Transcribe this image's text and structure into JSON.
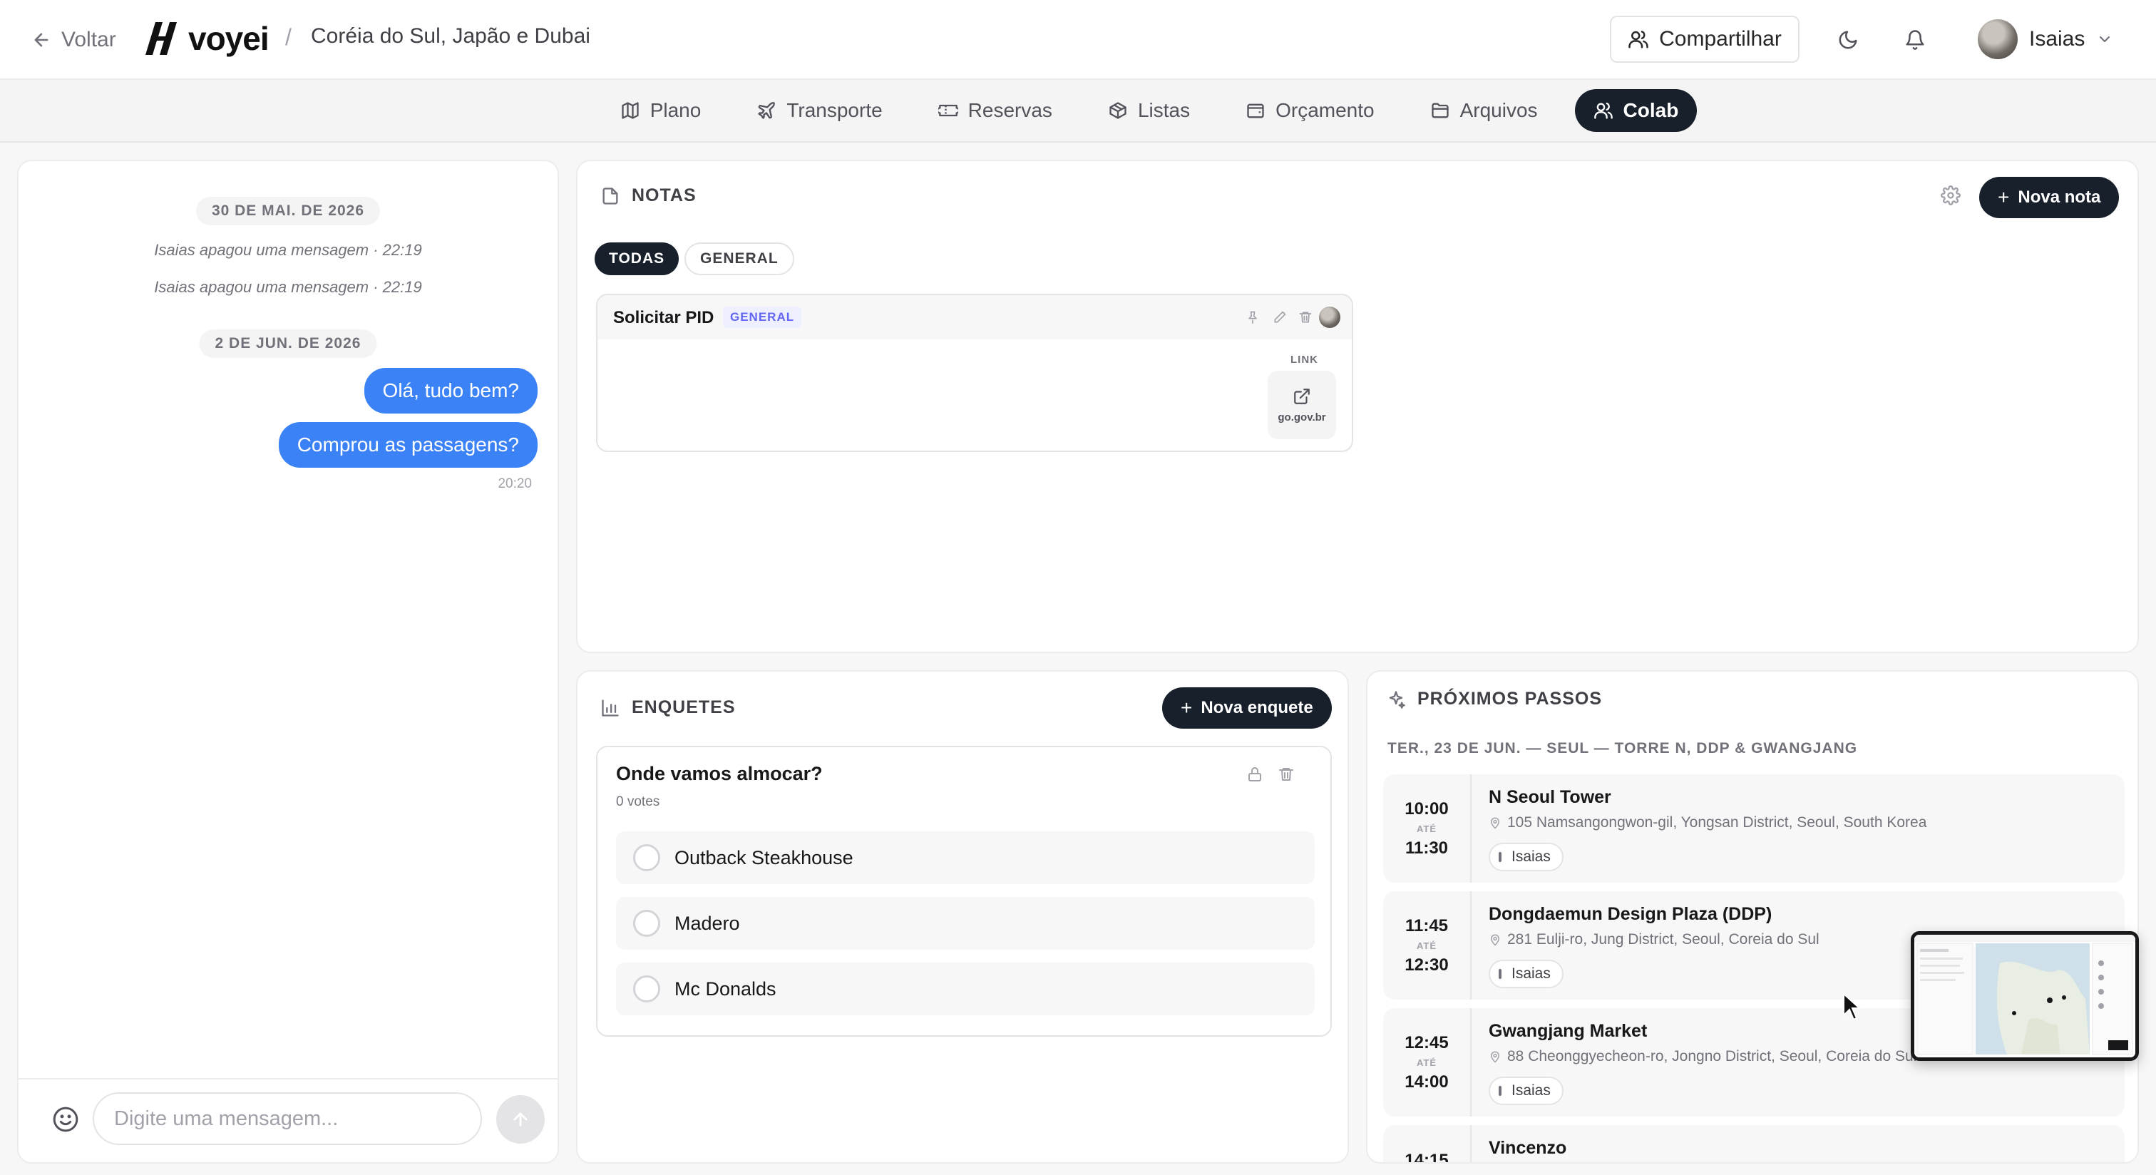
{
  "header": {
    "back_label": "Voltar",
    "brand": "voyei",
    "separator": "/",
    "trip_title": "Coréia do Sul, Japão e Dubai",
    "share_label": "Compartilhar",
    "user_name": "Isaias"
  },
  "tabs": [
    {
      "label": "Plano",
      "icon": "map-icon",
      "active": false
    },
    {
      "label": "Transporte",
      "icon": "plane-icon",
      "active": false
    },
    {
      "label": "Reservas",
      "icon": "ticket-icon",
      "active": false
    },
    {
      "label": "Listas",
      "icon": "package-icon",
      "active": false
    },
    {
      "label": "Orçamento",
      "icon": "wallet-icon",
      "active": false
    },
    {
      "label": "Arquivos",
      "icon": "folder-icon",
      "active": false
    },
    {
      "label": "Colab",
      "icon": "users-icon",
      "active": true
    }
  ],
  "chat": {
    "date1": "30 DE MAI. DE 2026",
    "system_msgs": [
      "Isaias apagou uma mensagem · 22:19",
      "Isaias apagou uma mensagem · 22:19"
    ],
    "date2": "2 DE JUN. DE 2026",
    "messages": [
      {
        "text": "Olá, tudo bem?"
      },
      {
        "text": "Comprou as passagens?"
      }
    ],
    "last_time": "20:20",
    "input_placeholder": "Digite uma mensagem..."
  },
  "notes": {
    "title": "NOTAS",
    "new_label": "Nova nota",
    "filters": [
      {
        "label": "TODAS",
        "active": true
      },
      {
        "label": "GENERAL",
        "active": false
      }
    ],
    "items": [
      {
        "title": "Solicitar PID",
        "tag": "GENERAL",
        "link_label": "LINK",
        "link_host": "go.gov.br"
      }
    ]
  },
  "polls": {
    "title": "ENQUETES",
    "new_label": "Nova enquete",
    "question": "Onde vamos almocar?",
    "votes": "0 votes",
    "options": [
      "Outback Steakhouse",
      "Madero",
      "Mc Donalds"
    ]
  },
  "next_steps": {
    "title": "PRÓXIMOS PASSOS",
    "day": "TER., 23 DE JUN. — SEUL — TORRE N, DDP & GWANGJANG",
    "ate_label": "ATÉ",
    "items": [
      {
        "start": "10:00",
        "end": "11:30",
        "name": "N Seoul Tower",
        "address": "105 Namsangongwon-gil, Yongsan District, Seoul, South Korea",
        "who": "Isaias"
      },
      {
        "start": "11:45",
        "end": "12:30",
        "name": "Dongdaemun Design Plaza (DDP)",
        "address": "281 Eulji-ro, Jung District, Seoul, Coreia do Sul",
        "who": "Isaias"
      },
      {
        "start": "12:45",
        "end": "14:00",
        "name": "Gwangjang Market",
        "address": "88 Cheonggyecheon-ro, Jongno District, Seoul, Coreia do Sul",
        "who": "Isaias"
      },
      {
        "start": "14:15",
        "end": "",
        "name": "Vincenzo",
        "address": "",
        "who": ""
      }
    ]
  },
  "colors": {
    "accent_dark": "#18202b",
    "bubble_blue": "#3b82f6",
    "tag_purple": "#6366f1"
  }
}
